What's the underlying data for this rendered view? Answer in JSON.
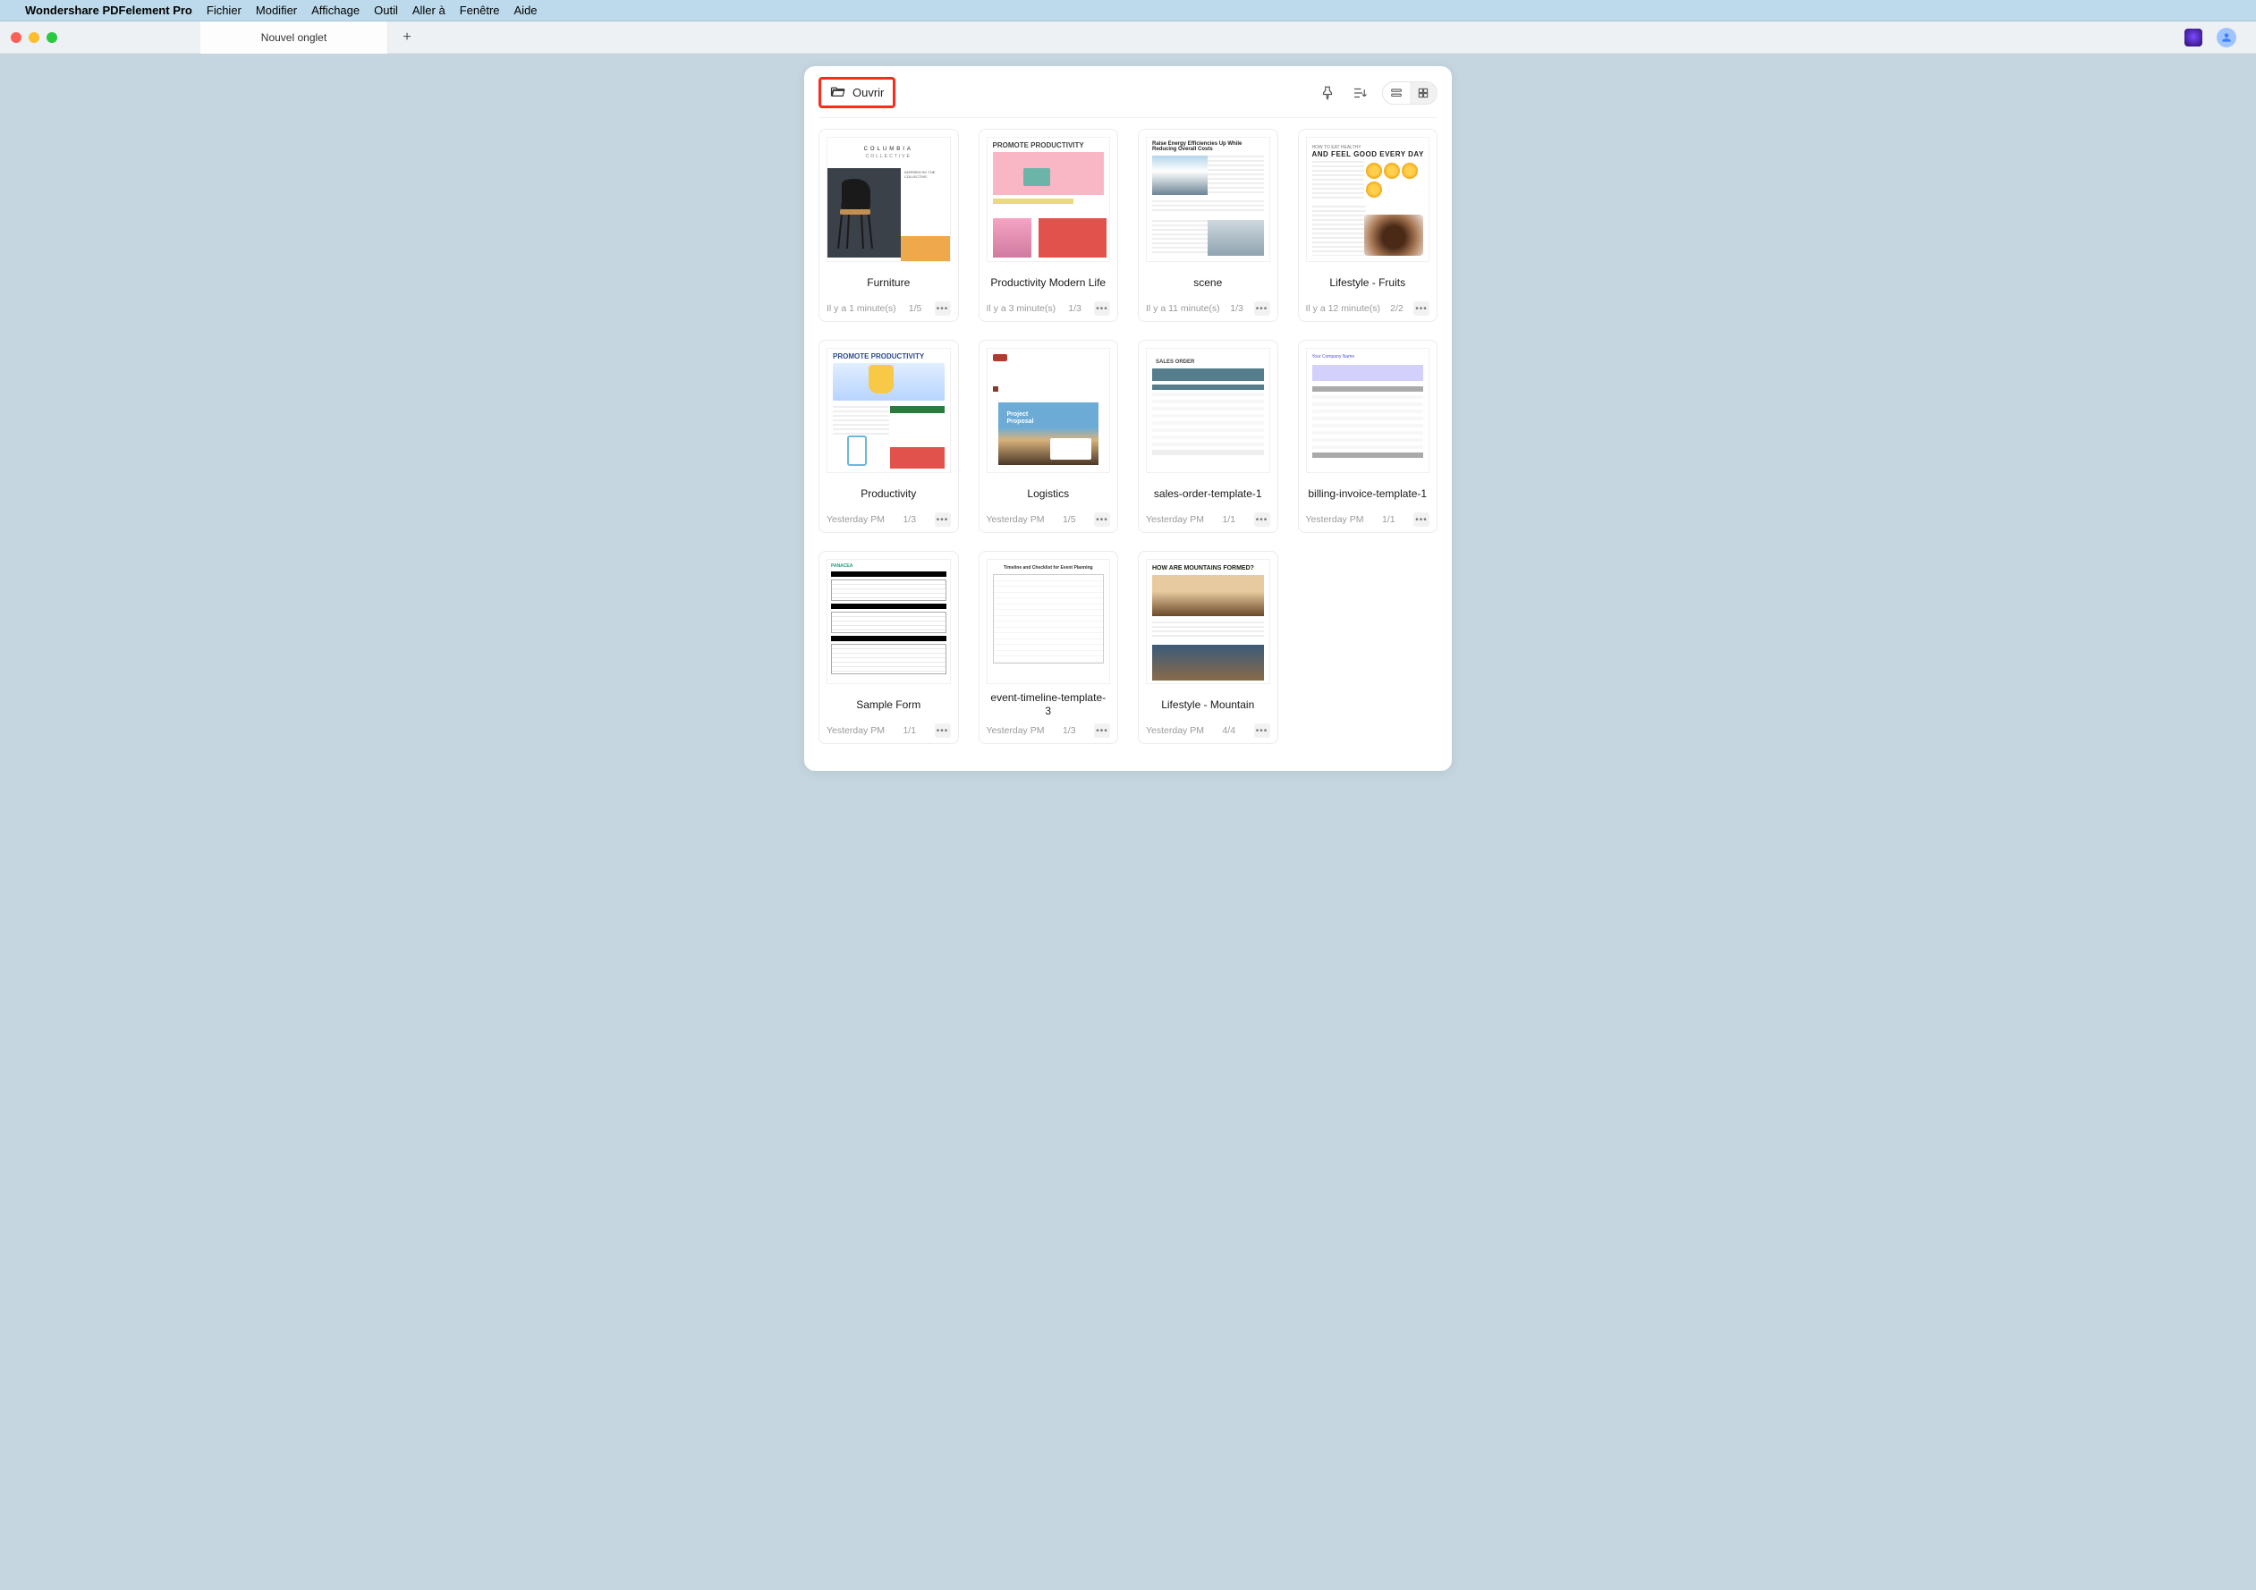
{
  "menubar": {
    "app_name": "Wondershare PDFelement Pro",
    "items": [
      "Fichier",
      "Modifier",
      "Affichage",
      "Outil",
      "Aller à",
      "Fenêtre",
      "Aide"
    ]
  },
  "tabbar": {
    "tab_label": "Nouvel onglet",
    "new_tab_tooltip": "Nouvel onglet"
  },
  "toolbar": {
    "open_label": "Ouvrir",
    "icons": {
      "pin": "pin-icon",
      "sort": "sort-icon",
      "list": "listview-icon",
      "grid": "gridview-icon"
    },
    "view_mode": "grid"
  },
  "documents": [
    {
      "title": "Furniture",
      "time": "Il y a 1 minute(s)",
      "pages": "1/5",
      "thumb": "furniture"
    },
    {
      "title": "Productivity Modern Life",
      "time": "Il y a 3 minute(s)",
      "pages": "1/3",
      "thumb": "prod-modern"
    },
    {
      "title": "scene",
      "time": "Il y a 11 minute(s)",
      "pages": "1/3",
      "thumb": "scene"
    },
    {
      "title": "Lifestyle - Fruits",
      "time": "Il y a 12 minute(s)",
      "pages": "2/2",
      "thumb": "fruits"
    },
    {
      "title": "Productivity",
      "time": "Yesterday PM",
      "pages": "1/3",
      "thumb": "productivity"
    },
    {
      "title": "Logistics",
      "time": "Yesterday PM",
      "pages": "1/5",
      "thumb": "logistics"
    },
    {
      "title": "sales-order-template-1",
      "time": "Yesterday PM",
      "pages": "1/1",
      "thumb": "sales"
    },
    {
      "title": "billing-invoice-template-1",
      "time": "Yesterday PM",
      "pages": "1/1",
      "thumb": "billing"
    },
    {
      "title": "Sample Form",
      "time": "Yesterday PM",
      "pages": "1/1",
      "thumb": "form"
    },
    {
      "title": "event-timeline-template-3",
      "time": "Yesterday PM",
      "pages": "1/3",
      "thumb": "event"
    },
    {
      "title": "Lifestyle - Mountain",
      "time": "Yesterday PM",
      "pages": "4/4",
      "thumb": "mountain"
    }
  ],
  "thumb_text": {
    "furniture": {
      "brand": "COLUMBIA",
      "brand2": "COLLECTIVE",
      "side": "INSPIRED BY THE COLLECTIVE."
    },
    "prod_modern": {
      "hdr": "PROMOTE PRODUCTIVITY"
    },
    "scene": {
      "title": "Raise Energy Efficiencies Up While Reducing Overall Costs"
    },
    "fruits": {
      "h1": "HOW TO EAT HEALTHY",
      "h2": "AND FEEL GOOD EVERY DAY"
    },
    "productivity": {
      "hdr": "PROMOTE PRODUCTIVITY"
    },
    "logistics": {
      "label": "Project\nProposal"
    },
    "sales": {
      "title": "SALES ORDER"
    },
    "billing": {
      "company": "Your Company Name"
    },
    "form": {
      "brand": "PANACEA"
    },
    "event": {
      "title": "Timeline and Checklist for Event Planning"
    },
    "mountain": {
      "q": "HOW ARE MOUNTAINS FORMED?"
    }
  }
}
